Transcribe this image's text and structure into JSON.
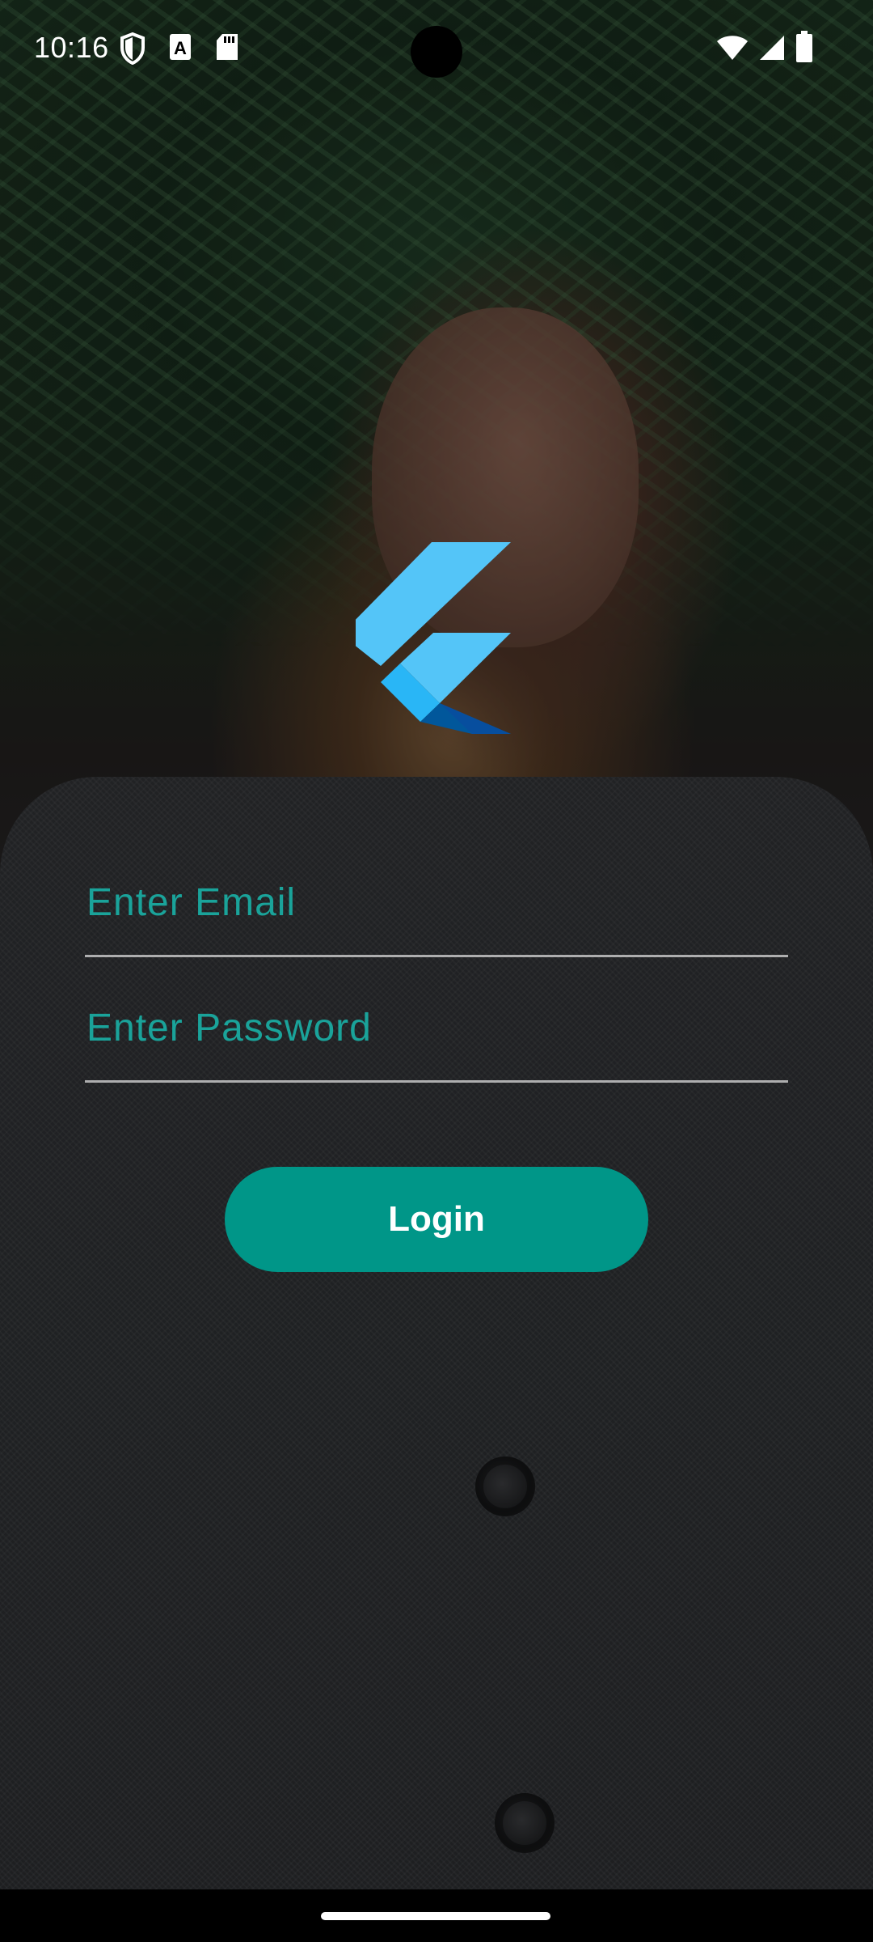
{
  "status_bar": {
    "time": "10:16",
    "icons_left": [
      "shield-icon",
      "font-a-icon",
      "sd-card-icon"
    ],
    "icons_right": [
      "wifi-icon",
      "signal-icon",
      "battery-icon"
    ]
  },
  "logo": {
    "icon": "flutter-logo-icon"
  },
  "form": {
    "email_placeholder": "Enter Email",
    "password_placeholder": "Enter Password",
    "login_label": "Login"
  },
  "colors": {
    "accent": "#009688",
    "placeholder": "#1AA39A",
    "logo_light": "#54C5F8",
    "logo_mid": "#29B6F6",
    "logo_dark": "#01579B"
  }
}
